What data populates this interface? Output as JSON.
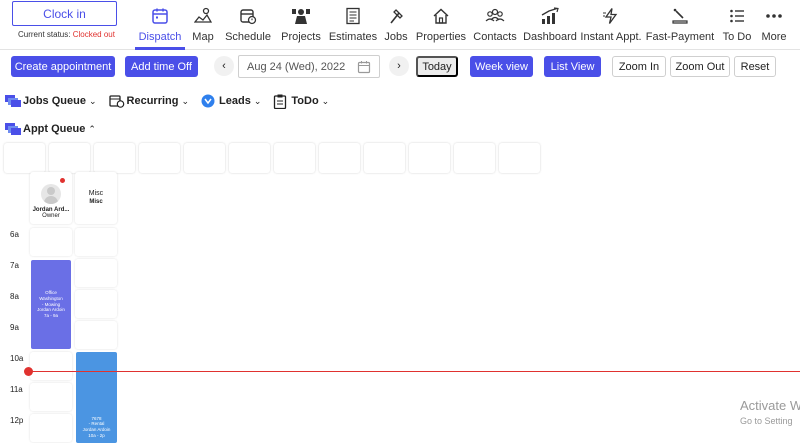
{
  "clock": {
    "button_label": "Clock in",
    "status_label": "Current status:",
    "status_value": "Clocked out"
  },
  "nav": [
    {
      "label": "Dispatch",
      "icon": "calendar-icon",
      "active": true
    },
    {
      "label": "Map",
      "icon": "map-icon"
    },
    {
      "label": "Schedule",
      "icon": "schedule-icon"
    },
    {
      "label": "Projects",
      "icon": "projects-icon"
    },
    {
      "label": "Estimates",
      "icon": "estimates-icon"
    },
    {
      "label": "Jobs",
      "icon": "hammer-icon"
    },
    {
      "label": "Properties",
      "icon": "home-icon"
    },
    {
      "label": "Contacts",
      "icon": "contacts-icon"
    },
    {
      "label": "Dashboard",
      "icon": "chart-icon"
    },
    {
      "label": "Instant Appt.",
      "icon": "lightning-icon"
    },
    {
      "label": "Fast-Payment",
      "icon": "payment-icon"
    },
    {
      "label": "To Do",
      "icon": "list-icon"
    },
    {
      "label": "More",
      "icon": "more-icon"
    }
  ],
  "toolbar": {
    "create_appointment": "Create appointment",
    "add_time_off": "Add time Off",
    "date_value": "Aug 24 (Wed), 2022",
    "today": "Today",
    "week_view": "Week view",
    "list_view": "List View",
    "zoom_in": "Zoom In",
    "zoom_out": "Zoom Out",
    "reset": "Reset"
  },
  "queues": {
    "jobs": "Jobs Queue",
    "recurring": "Recurring",
    "leads": "Leads",
    "todo": "ToDo",
    "appt": "Appt Queue"
  },
  "technicians": [
    {
      "name": "Jordan Ard...",
      "role": "Owner"
    },
    {
      "name": "Misc",
      "role": "Misc"
    }
  ],
  "hours": [
    "6a",
    "7a",
    "8a",
    "9a",
    "10a",
    "11a",
    "12p"
  ],
  "appointments": [
    {
      "line1": "Office",
      "line2": "Washington",
      "line3": "- Mowing",
      "line4": "Jordan Ardoin",
      "line5": "7a - 9a",
      "color": "#6a6fe6"
    },
    {
      "line1": "7678",
      "line2": "- Rental",
      "line3": "Jordan Ardoin",
      "line4": "10a - 2p",
      "color": "#4b95e2"
    }
  ],
  "watermark": {
    "title": "Activate W",
    "subtitle": "Go to Setting"
  },
  "colors": {
    "accent": "#4a4fe8",
    "danger": "#e0322f"
  }
}
